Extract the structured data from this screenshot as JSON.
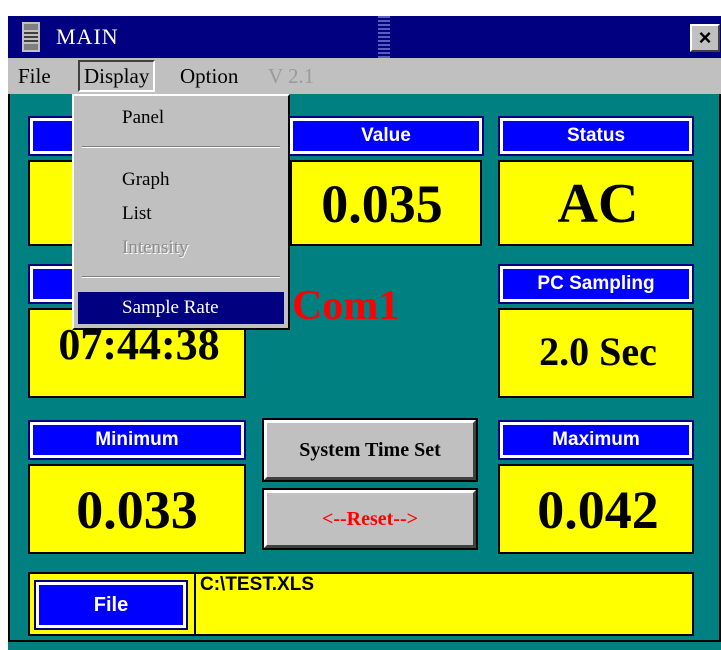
{
  "window": {
    "title": "MAIN",
    "close_glyph": "×"
  },
  "menubar": {
    "items": [
      "File",
      "Display",
      "Option"
    ],
    "version": "V 2.1"
  },
  "dropdown": {
    "items": [
      {
        "label": "Panel",
        "enabled": true
      },
      {
        "label": "Graph",
        "enabled": true
      },
      {
        "label": "List",
        "enabled": true
      },
      {
        "label": "Intensity",
        "enabled": false
      },
      {
        "label": "Sample Rate",
        "enabled": true,
        "highlighted": true
      }
    ]
  },
  "panels": {
    "value": {
      "label": "Value",
      "reading": "0.035"
    },
    "status": {
      "label": "Status",
      "reading": "AC"
    },
    "time": {
      "reading": "07:44:38"
    },
    "pc_sampling": {
      "label": "PC Sampling",
      "reading": "2.0 Sec"
    },
    "com_port": "Com1",
    "minimum": {
      "label": "Minimum",
      "reading": "0.033"
    },
    "maximum": {
      "label": "Maximum",
      "reading": "0.042"
    },
    "file": {
      "label": "File",
      "path": "C:\\TEST.XLS"
    }
  },
  "buttons": {
    "system_time_set": "System Time Set",
    "reset": "<--Reset-->"
  },
  "colors": {
    "background": "#008080",
    "panel_yellow": "#ffff00",
    "header_blue": "#0000ff",
    "titlebar": "#000080",
    "com_red": "#ff0000"
  }
}
